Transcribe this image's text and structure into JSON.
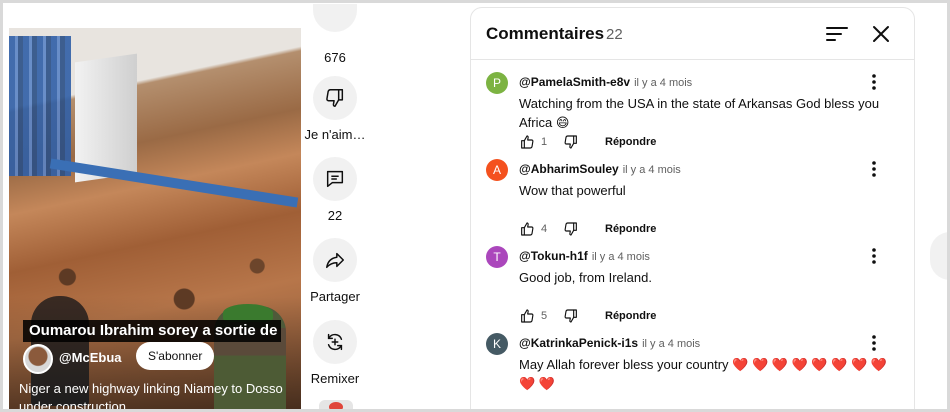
{
  "video": {
    "caption": "Oumarou Ibrahim sorey a sortie de Niamey route",
    "channel_handle": "@McEbua",
    "subscribe_label": "S'abonner",
    "description": "Niger a new highway linking Niamey to Dosso under construction"
  },
  "actions": {
    "like_count": "676",
    "dislike_label": "Je n'aim…",
    "comments_count": "22",
    "share_label": "Partager",
    "remix_label": "Remixer"
  },
  "comments_panel": {
    "title": "Commentaires",
    "count": "22",
    "comments": [
      {
        "avatar_letter": "P",
        "avatar_color": "#7cb342",
        "author": "@PamelaSmith-e8v",
        "time": "il y a 4 mois",
        "text": "Watching from the USA in the state of Arkansas God bless you Africa 😄",
        "likes": "1",
        "reply_label": "Répondre"
      },
      {
        "avatar_letter": "A",
        "avatar_color": "#f4511e",
        "author": "@AbharimSouley",
        "time": "il y a 4 mois",
        "text": "Wow that powerful",
        "likes": "4",
        "reply_label": "Répondre"
      },
      {
        "avatar_letter": "T",
        "avatar_color": "#ab47bc",
        "author": "@Tokun-h1f",
        "time": "il y a 4 mois",
        "text": "Good job, from  Ireland.",
        "likes": "5",
        "reply_label": "Répondre"
      },
      {
        "avatar_letter": "K",
        "avatar_color": "#455a64",
        "author": "@KatrinkaPenick-i1s",
        "time": "il y a 4 mois",
        "text": "May Allah forever bless your country ❤️ ❤️ ❤️ ❤️ ❤️ ❤️ ❤️ ❤️ ❤️ ❤️",
        "likes": "",
        "reply_label": "Répondre"
      }
    ]
  },
  "icons": {
    "dislike": "thumbs-down-icon",
    "comment": "comment-icon",
    "share": "share-arrow-icon",
    "remix": "remix-icon",
    "sort": "sort-icon",
    "close": "close-icon",
    "like": "thumbs-up-icon",
    "more": "more-vertical-icon"
  }
}
